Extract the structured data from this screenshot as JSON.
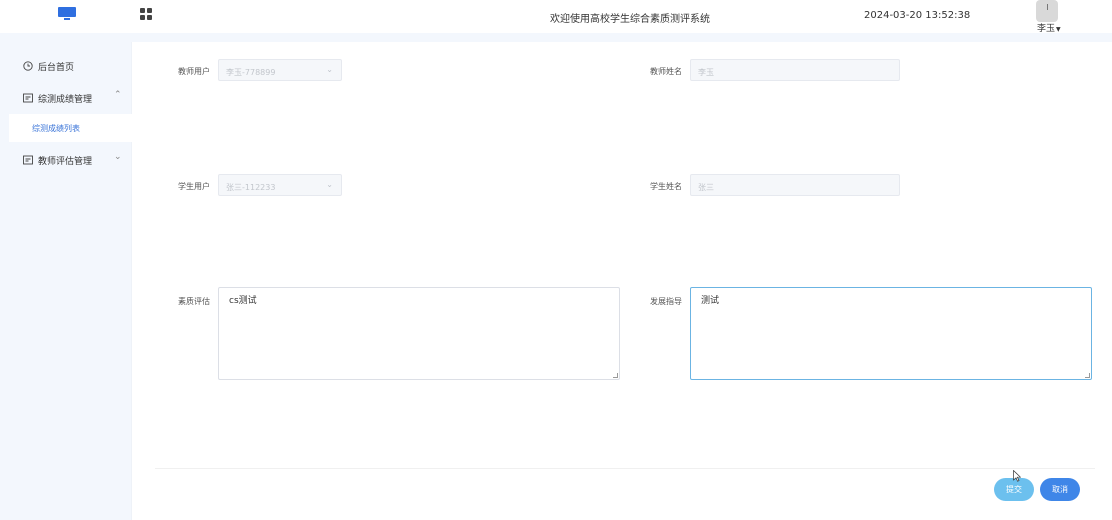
{
  "header": {
    "title": "欢迎使用高校学生综合素质测评系统",
    "datetime": "2024-03-20 13:52:38",
    "user": "李玉",
    "logo_icon": "monitor-icon",
    "menu_icon": "grid-icon"
  },
  "sidebar": {
    "items": [
      {
        "label": "后台首页",
        "icon": "clock-icon"
      },
      {
        "label": "综测成绩管理",
        "icon": "list-icon",
        "expanded": true
      },
      {
        "label": "综测成绩列表",
        "active": true
      },
      {
        "label": "教师评估管理",
        "icon": "list-icon",
        "expanded": false
      }
    ]
  },
  "form": {
    "teacher_user_label": "教师用户",
    "teacher_user_value": "李玉-778899",
    "teacher_name_label": "教师姓名",
    "teacher_name_value": "李玉",
    "student_user_label": "学生用户",
    "student_user_value": "张三-112233",
    "student_name_label": "学生姓名",
    "student_name_value": "张三",
    "quality_eval_label": "素质评估",
    "quality_eval_value": "cs测试",
    "guidance_label": "发展指导",
    "guidance_value": "测试"
  },
  "buttons": {
    "submit": "提交",
    "cancel": "取消"
  },
  "colors": {
    "accent": "#3f86e8",
    "submit": "#6cc0ee",
    "sidebar_bg": "#f3f7fd",
    "active_text": "#3a74d8"
  }
}
